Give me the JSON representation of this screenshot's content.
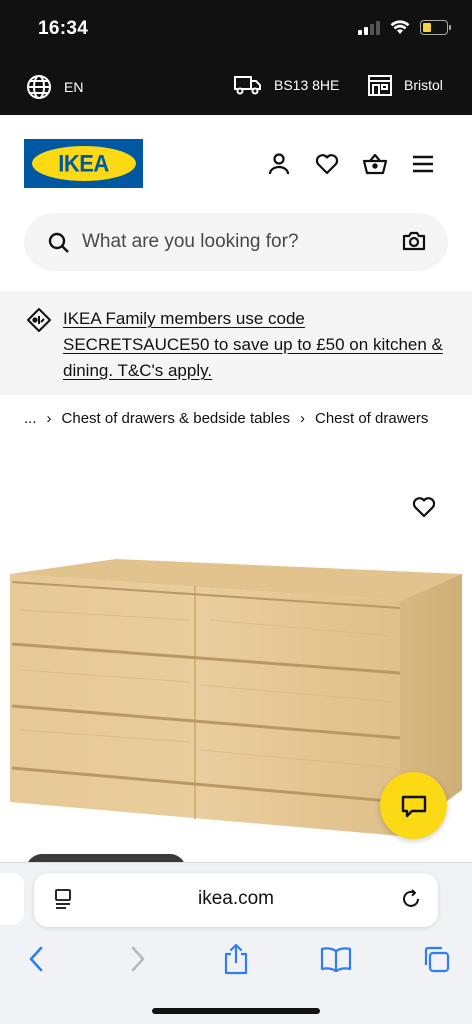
{
  "status_bar": {
    "time": "16:34"
  },
  "info_bar": {
    "language": "EN",
    "postcode": "BS13 8HE",
    "store": "Bristol"
  },
  "header": {
    "logo_text": "IKEA"
  },
  "search": {
    "placeholder": "What are you looking for?"
  },
  "promo": {
    "text": "IKEA Family members use code SECRETSAUCE50 to save up to £50 on kitchen & dining. T&C's apply."
  },
  "breadcrumb": {
    "ellipsis": "...",
    "items": [
      "Chest of drawers & bedside tables",
      "Chest of drawers"
    ]
  },
  "browser": {
    "url": "ikea.com"
  },
  "colors": {
    "ikea_blue": "#0058a3",
    "ikea_yellow": "#fbd914",
    "ios_blue": "#2f7df6"
  },
  "icons": {
    "language": "globe-icon",
    "delivery": "truck-icon",
    "store": "store-icon",
    "account": "user-icon",
    "wishlist": "heart-icon",
    "cart": "basket-icon",
    "menu": "hamburger-icon",
    "search": "search-icon",
    "visual_search": "camera-icon",
    "promo": "tag-icon",
    "chat": "chat-icon"
  }
}
